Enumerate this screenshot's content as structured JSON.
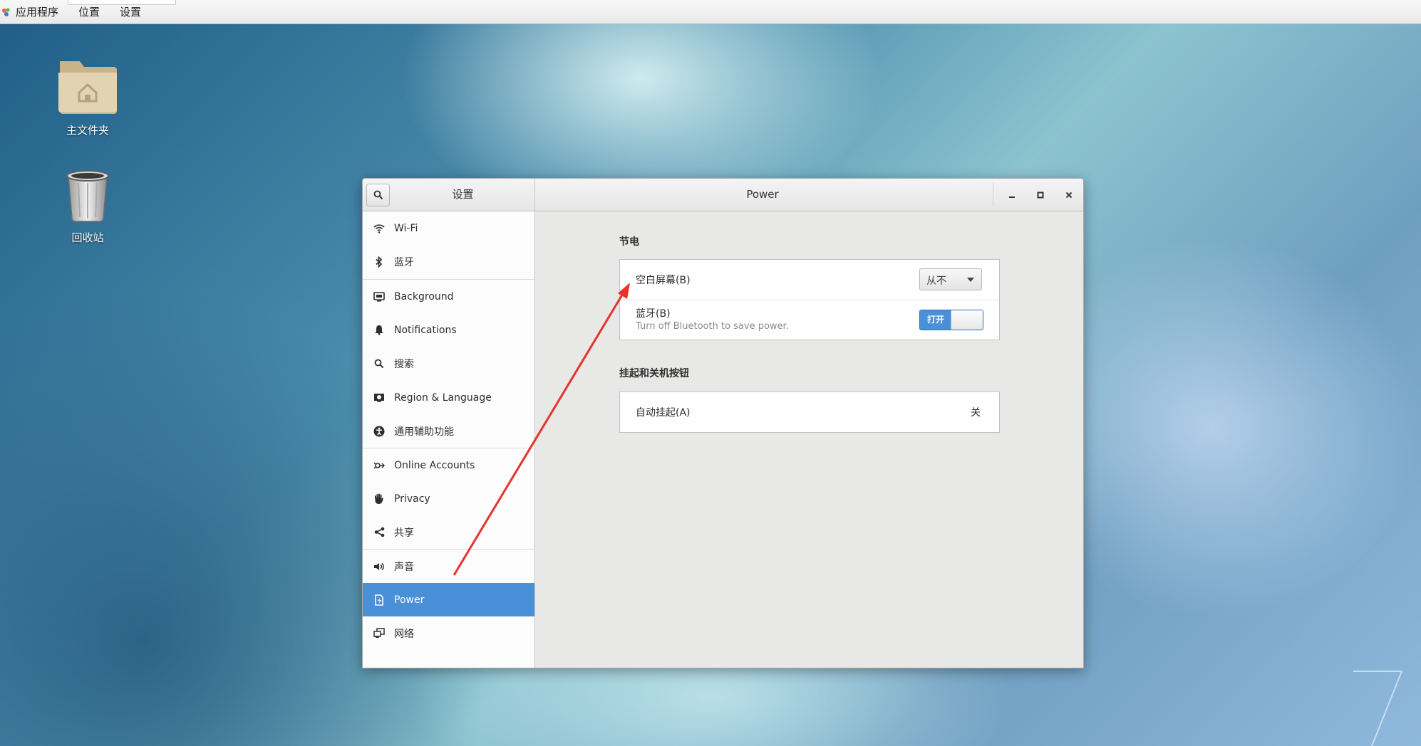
{
  "topbar": {
    "menus": [
      "应用程序",
      "位置",
      "设置"
    ]
  },
  "desktop": {
    "icons": [
      {
        "label": "主文件夹",
        "icon": "home-folder-icon"
      },
      {
        "label": "回收站",
        "icon": "trash-icon"
      }
    ]
  },
  "window": {
    "sidebar_title": "设置",
    "panel_title": "Power",
    "sidebar_items": [
      {
        "label": "Wi-Fi",
        "icon": "wifi-icon"
      },
      {
        "label": "蓝牙",
        "icon": "bluetooth-icon"
      },
      {
        "label": "Background",
        "icon": "background-icon"
      },
      {
        "label": "Notifications",
        "icon": "bell-icon"
      },
      {
        "label": "搜索",
        "icon": "search-icon"
      },
      {
        "label": "Region & Language",
        "icon": "region-icon"
      },
      {
        "label": "通用辅助功能",
        "icon": "accessibility-icon"
      },
      {
        "label": "Online Accounts",
        "icon": "online-accounts-icon"
      },
      {
        "label": "Privacy",
        "icon": "privacy-hand-icon"
      },
      {
        "label": "共享",
        "icon": "share-icon"
      },
      {
        "label": "声音",
        "icon": "speaker-icon"
      },
      {
        "label": "Power",
        "icon": "power-icon",
        "selected": true
      },
      {
        "label": "网络",
        "icon": "network-icon"
      }
    ],
    "sections": {
      "power_saving": {
        "title": "节电",
        "blank_screen_label": "空白屏幕(B)",
        "blank_screen_value": "从不",
        "bluetooth_label": "蓝牙(B)",
        "bluetooth_desc": "Turn off Bluetooth to save power.",
        "bluetooth_switch": "打开"
      },
      "suspend": {
        "title": "挂起和关机按钮",
        "auto_suspend_label": "自动挂起(A)",
        "auto_suspend_value": "关"
      }
    }
  },
  "colors": {
    "accent": "#4a90d9",
    "annotation_arrow": "#e8322a"
  }
}
